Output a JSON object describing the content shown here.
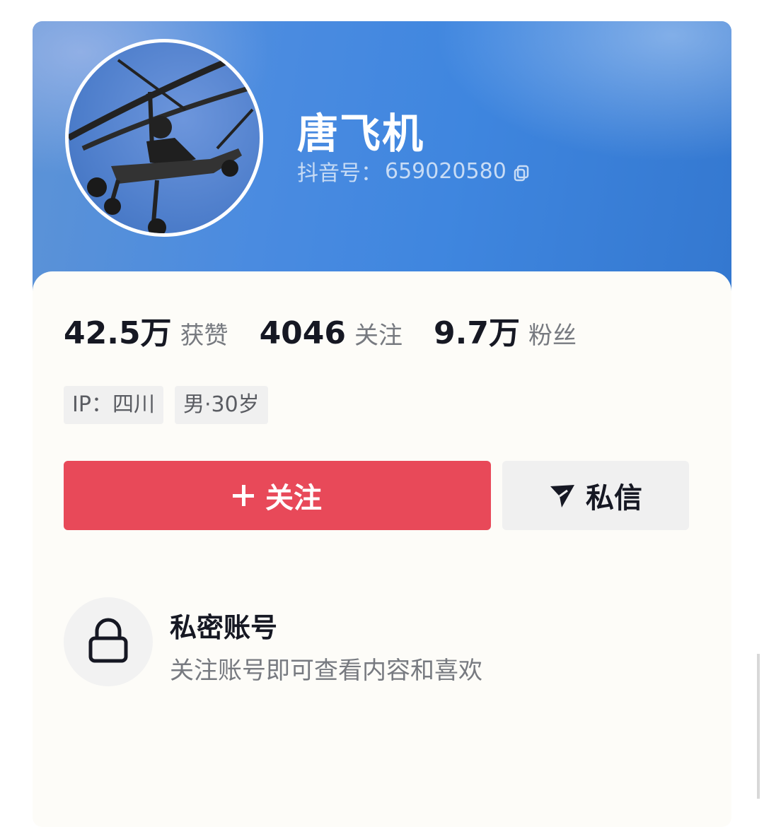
{
  "profile": {
    "username": "唐飞机",
    "douyin_id_label": "抖音号：",
    "douyin_id": "659020580",
    "avatar_icon": "gyrocopter-photo"
  },
  "stats": [
    {
      "value": "42.5万",
      "label": "获赞"
    },
    {
      "value": "4046",
      "label": "关注"
    },
    {
      "value": "9.7万",
      "label": "粉丝"
    }
  ],
  "tags": [
    "IP：四川",
    "男·30岁"
  ],
  "actions": {
    "follow_label": "关注",
    "message_label": "私信"
  },
  "private_account": {
    "title": "私密账号",
    "description": "关注账号即可查看内容和喜欢",
    "icon": "lock-icon"
  },
  "colors": {
    "header_blue": "#3f86df",
    "follow_red": "#e84959",
    "secondary_button": "#f0f0f0"
  }
}
